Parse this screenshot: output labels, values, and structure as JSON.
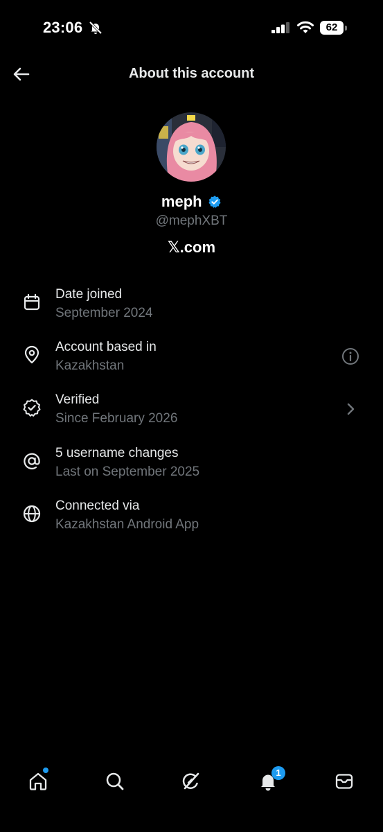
{
  "status_bar": {
    "time": "23:06",
    "battery": "62"
  },
  "header": {
    "title": "About this account"
  },
  "profile": {
    "name": "meph",
    "handle": "@mephXBT",
    "site": "𝕏.com"
  },
  "rows": [
    {
      "title": "Date joined",
      "subtitle": "September 2024",
      "icon": "calendar-icon"
    },
    {
      "title": "Account based in",
      "subtitle": "Kazakhstan",
      "icon": "location-pin-icon",
      "trailing": "info-icon"
    },
    {
      "title": "Verified",
      "subtitle": "Since February 2026",
      "icon": "verified-badge-icon",
      "trailing": "chevron-right-icon"
    },
    {
      "title": "5 username changes",
      "subtitle": "Last on September 2025",
      "icon": "at-sign-icon"
    },
    {
      "title": "Connected via",
      "subtitle": "Kazakhstan Android App",
      "icon": "globe-icon"
    }
  ],
  "tab_bar": {
    "tabs": [
      "home",
      "search",
      "grok",
      "notifications",
      "messages"
    ],
    "notifications_count": "1"
  },
  "colors": {
    "accent": "#1d9bf0",
    "muted": "#71767b",
    "text": "#e7e9ea",
    "background": "#000000"
  }
}
